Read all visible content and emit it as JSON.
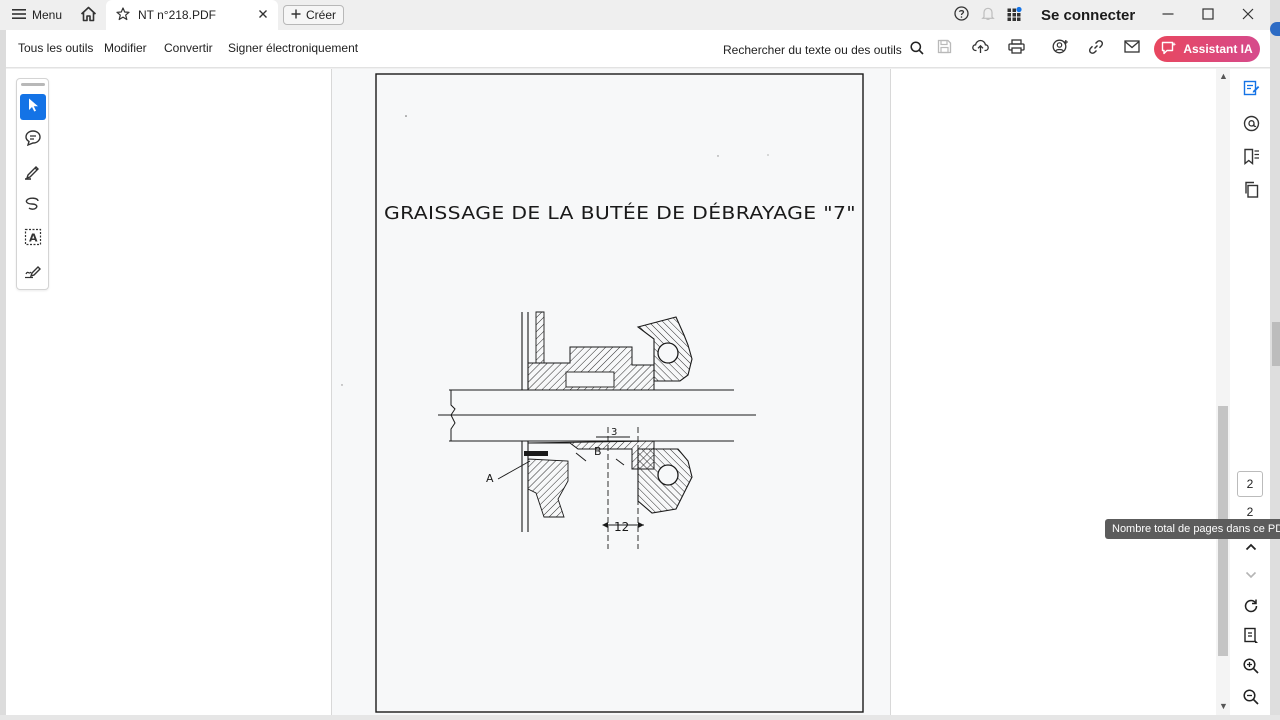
{
  "titlebar": {
    "menu_label": "Menu",
    "tab_title": "NT n°218.PDF",
    "create_label": "Créer",
    "signin_label": "Se connecter"
  },
  "toolbar": {
    "all_tools": "Tous les outils",
    "edit": "Modifier",
    "convert": "Convertir",
    "sign": "Signer électroniquement",
    "search_tools": "Rechercher du texte ou des outils",
    "ai_assistant": "Assistant IA"
  },
  "document": {
    "drawing_title": "GRAISSAGE DE LA BUTÉE DE DÉBRAYAGE \"7\"",
    "label_a": "A",
    "label_b": "B",
    "dim_3": "3",
    "dim_12": "12"
  },
  "navigation": {
    "current_page": "2",
    "total_pages": "2",
    "total_pages_tooltip": "Nombre total de pages dans ce PDF"
  },
  "colors": {
    "accent": "#1473e6",
    "ai_gradient_start": "#e8475f",
    "ai_gradient_end": "#d64a8c"
  },
  "icons": {
    "left_tools": [
      "select-pointer-icon",
      "comment-icon",
      "highlight-pen-icon",
      "freehand-draw-icon",
      "text-select-icon",
      "signature-icon"
    ],
    "right_rail": [
      "edit-doc-icon",
      "mention-icon",
      "bookmarks-icon",
      "copy-pages-icon"
    ]
  }
}
